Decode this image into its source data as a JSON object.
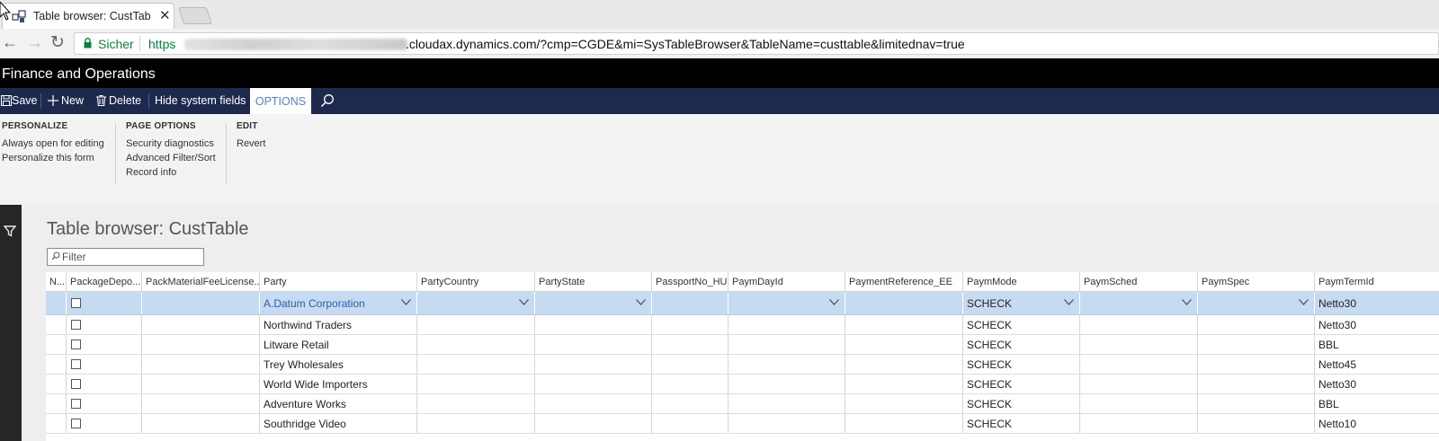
{
  "browser": {
    "tab_title": "Table browser: CustTable",
    "close_glyph": "✕",
    "secure_label": "Sicher",
    "url_scheme": "https",
    "url_visible": ".cloudax.dynamics.com/?cmp=CGDE&mi=SysTableBrowser&TableName=custtable&limitednav=true",
    "back_glyph": "←",
    "forward_glyph": "→",
    "reload_glyph": "↻"
  },
  "app": {
    "title": "Finance and Operations"
  },
  "actionpane": {
    "save": "Save",
    "new": "New",
    "delete": "Delete",
    "hide_system_fields": "Hide system fields",
    "options": "OPTIONS"
  },
  "ribbon": {
    "groups": [
      {
        "header": "PERSONALIZE",
        "items": [
          "Always open for editing",
          "Personalize this form"
        ]
      },
      {
        "header": "PAGE OPTIONS",
        "items": [
          "Security diagnostics",
          "Advanced Filter/Sort",
          "Record info"
        ]
      },
      {
        "header": "EDIT",
        "items": [
          "Revert"
        ]
      }
    ]
  },
  "form": {
    "title": "Table browser: CustTable",
    "filter_placeholder": "Filter"
  },
  "grid": {
    "columns": [
      "N...",
      "PackageDepo...",
      "PackMaterialFeeLicense...",
      "Party",
      "PartyCountry",
      "PartyState",
      "PassportNo_HU",
      "PaymDayId",
      "PaymentReference_EE",
      "PaymMode",
      "PaymSched",
      "PaymSpec",
      "PaymTermId"
    ],
    "rows": [
      {
        "party": "A.Datum Corporation",
        "paym_mode": "SCHECK",
        "paym_term": "Netto30",
        "selected": true
      },
      {
        "party": "Northwind Traders",
        "paym_mode": "SCHECK",
        "paym_term": "Netto30",
        "selected": false
      },
      {
        "party": "Litware Retail",
        "paym_mode": "SCHECK",
        "paym_term": "BBL",
        "selected": false
      },
      {
        "party": "Trey Wholesales",
        "paym_mode": "SCHECK",
        "paym_term": "Netto45",
        "selected": false
      },
      {
        "party": "World Wide Importers",
        "paym_mode": "SCHECK",
        "paym_term": "Netto30",
        "selected": false
      },
      {
        "party": "Adventure Works",
        "paym_mode": "SCHECK",
        "paym_term": "BBL",
        "selected": false
      },
      {
        "party": "Southridge Video",
        "paym_mode": "SCHECK",
        "paym_term": "Netto10",
        "selected": false
      }
    ]
  },
  "colors": {
    "header_bg": "#000000",
    "actionpane_bg": "#1d2a4d",
    "selected_row": "#c6dbf1",
    "secure_green": "#0b8043"
  }
}
